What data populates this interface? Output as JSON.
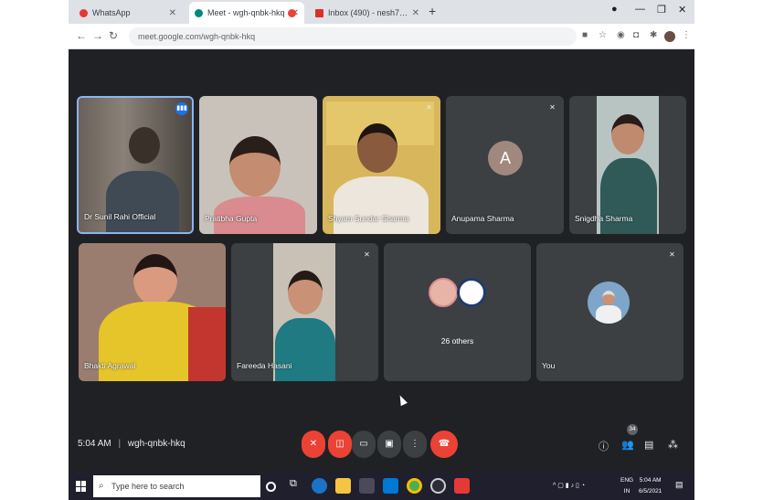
{
  "browser": {
    "tabs": [
      {
        "label": "WhatsApp",
        "favicon_color": "#e53935",
        "active": false
      },
      {
        "label": "Meet - wgh-qnbk-hkq",
        "favicon_color": "#00897b",
        "active": true
      },
      {
        "label": "",
        "favicon_color": "#ea4335",
        "active": false
      },
      {
        "label": "Inbox (490) - nesh787@gmail.co...",
        "favicon_color": "#d93025",
        "active": false
      }
    ],
    "new_tab": "+",
    "url": "meet.google.com/wgh-qnbk-hkq"
  },
  "meeting": {
    "participants": [
      {
        "name": "Dr Sunil Rahi Official",
        "speaking": true
      },
      {
        "name": "Pratibha Gupta"
      },
      {
        "name": "Shyam Sundar Sharma"
      },
      {
        "name": "Anupama Sharma",
        "initial": "A"
      },
      {
        "name": "Snigdha Sharma"
      },
      {
        "name": "Bhakti Agrawal"
      },
      {
        "name": "Fareeda Hasani"
      },
      {
        "name": "26 others"
      },
      {
        "name": "You"
      }
    ],
    "time": "5:04 AM",
    "separator": "|",
    "code": "wgh-qnbk-hkq",
    "participant_count": "34"
  },
  "taskbar": {
    "search_placeholder": "Type here to search",
    "lang_line1": "ENG",
    "lang_line2": "IN",
    "clock_time": "5:04 AM",
    "clock_date": "6/5/2021"
  },
  "icons": [
    "whatsapp-icon",
    "meet-icon",
    "gmail-icon",
    "back-icon",
    "forward-icon",
    "reload-icon",
    "mic-off-icon",
    "camera-off-icon",
    "captions-icon",
    "present-icon",
    "more-icon",
    "end-call-icon",
    "info-icon",
    "people-icon",
    "chat-icon",
    "activities-icon",
    "windows-logo-icon",
    "search-icon"
  ]
}
